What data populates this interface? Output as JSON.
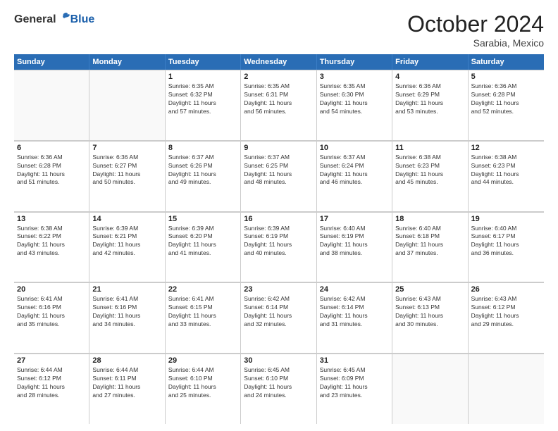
{
  "header": {
    "logo_general": "General",
    "logo_blue": "Blue",
    "month_title": "October 2024",
    "subtitle": "Sarabia, Mexico"
  },
  "days_of_week": [
    "Sunday",
    "Monday",
    "Tuesday",
    "Wednesday",
    "Thursday",
    "Friday",
    "Saturday"
  ],
  "weeks": [
    [
      {
        "day": "",
        "lines": []
      },
      {
        "day": "",
        "lines": []
      },
      {
        "day": "1",
        "lines": [
          "Sunrise: 6:35 AM",
          "Sunset: 6:32 PM",
          "Daylight: 11 hours",
          "and 57 minutes."
        ]
      },
      {
        "day": "2",
        "lines": [
          "Sunrise: 6:35 AM",
          "Sunset: 6:31 PM",
          "Daylight: 11 hours",
          "and 56 minutes."
        ]
      },
      {
        "day": "3",
        "lines": [
          "Sunrise: 6:35 AM",
          "Sunset: 6:30 PM",
          "Daylight: 11 hours",
          "and 54 minutes."
        ]
      },
      {
        "day": "4",
        "lines": [
          "Sunrise: 6:36 AM",
          "Sunset: 6:29 PM",
          "Daylight: 11 hours",
          "and 53 minutes."
        ]
      },
      {
        "day": "5",
        "lines": [
          "Sunrise: 6:36 AM",
          "Sunset: 6:28 PM",
          "Daylight: 11 hours",
          "and 52 minutes."
        ]
      }
    ],
    [
      {
        "day": "6",
        "lines": [
          "Sunrise: 6:36 AM",
          "Sunset: 6:28 PM",
          "Daylight: 11 hours",
          "and 51 minutes."
        ]
      },
      {
        "day": "7",
        "lines": [
          "Sunrise: 6:36 AM",
          "Sunset: 6:27 PM",
          "Daylight: 11 hours",
          "and 50 minutes."
        ]
      },
      {
        "day": "8",
        "lines": [
          "Sunrise: 6:37 AM",
          "Sunset: 6:26 PM",
          "Daylight: 11 hours",
          "and 49 minutes."
        ]
      },
      {
        "day": "9",
        "lines": [
          "Sunrise: 6:37 AM",
          "Sunset: 6:25 PM",
          "Daylight: 11 hours",
          "and 48 minutes."
        ]
      },
      {
        "day": "10",
        "lines": [
          "Sunrise: 6:37 AM",
          "Sunset: 6:24 PM",
          "Daylight: 11 hours",
          "and 46 minutes."
        ]
      },
      {
        "day": "11",
        "lines": [
          "Sunrise: 6:38 AM",
          "Sunset: 6:23 PM",
          "Daylight: 11 hours",
          "and 45 minutes."
        ]
      },
      {
        "day": "12",
        "lines": [
          "Sunrise: 6:38 AM",
          "Sunset: 6:23 PM",
          "Daylight: 11 hours",
          "and 44 minutes."
        ]
      }
    ],
    [
      {
        "day": "13",
        "lines": [
          "Sunrise: 6:38 AM",
          "Sunset: 6:22 PM",
          "Daylight: 11 hours",
          "and 43 minutes."
        ]
      },
      {
        "day": "14",
        "lines": [
          "Sunrise: 6:39 AM",
          "Sunset: 6:21 PM",
          "Daylight: 11 hours",
          "and 42 minutes."
        ]
      },
      {
        "day": "15",
        "lines": [
          "Sunrise: 6:39 AM",
          "Sunset: 6:20 PM",
          "Daylight: 11 hours",
          "and 41 minutes."
        ]
      },
      {
        "day": "16",
        "lines": [
          "Sunrise: 6:39 AM",
          "Sunset: 6:19 PM",
          "Daylight: 11 hours",
          "and 40 minutes."
        ]
      },
      {
        "day": "17",
        "lines": [
          "Sunrise: 6:40 AM",
          "Sunset: 6:19 PM",
          "Daylight: 11 hours",
          "and 38 minutes."
        ]
      },
      {
        "day": "18",
        "lines": [
          "Sunrise: 6:40 AM",
          "Sunset: 6:18 PM",
          "Daylight: 11 hours",
          "and 37 minutes."
        ]
      },
      {
        "day": "19",
        "lines": [
          "Sunrise: 6:40 AM",
          "Sunset: 6:17 PM",
          "Daylight: 11 hours",
          "and 36 minutes."
        ]
      }
    ],
    [
      {
        "day": "20",
        "lines": [
          "Sunrise: 6:41 AM",
          "Sunset: 6:16 PM",
          "Daylight: 11 hours",
          "and 35 minutes."
        ]
      },
      {
        "day": "21",
        "lines": [
          "Sunrise: 6:41 AM",
          "Sunset: 6:16 PM",
          "Daylight: 11 hours",
          "and 34 minutes."
        ]
      },
      {
        "day": "22",
        "lines": [
          "Sunrise: 6:41 AM",
          "Sunset: 6:15 PM",
          "Daylight: 11 hours",
          "and 33 minutes."
        ]
      },
      {
        "day": "23",
        "lines": [
          "Sunrise: 6:42 AM",
          "Sunset: 6:14 PM",
          "Daylight: 11 hours",
          "and 32 minutes."
        ]
      },
      {
        "day": "24",
        "lines": [
          "Sunrise: 6:42 AM",
          "Sunset: 6:14 PM",
          "Daylight: 11 hours",
          "and 31 minutes."
        ]
      },
      {
        "day": "25",
        "lines": [
          "Sunrise: 6:43 AM",
          "Sunset: 6:13 PM",
          "Daylight: 11 hours",
          "and 30 minutes."
        ]
      },
      {
        "day": "26",
        "lines": [
          "Sunrise: 6:43 AM",
          "Sunset: 6:12 PM",
          "Daylight: 11 hours",
          "and 29 minutes."
        ]
      }
    ],
    [
      {
        "day": "27",
        "lines": [
          "Sunrise: 6:44 AM",
          "Sunset: 6:12 PM",
          "Daylight: 11 hours",
          "and 28 minutes."
        ]
      },
      {
        "day": "28",
        "lines": [
          "Sunrise: 6:44 AM",
          "Sunset: 6:11 PM",
          "Daylight: 11 hours",
          "and 27 minutes."
        ]
      },
      {
        "day": "29",
        "lines": [
          "Sunrise: 6:44 AM",
          "Sunset: 6:10 PM",
          "Daylight: 11 hours",
          "and 25 minutes."
        ]
      },
      {
        "day": "30",
        "lines": [
          "Sunrise: 6:45 AM",
          "Sunset: 6:10 PM",
          "Daylight: 11 hours",
          "and 24 minutes."
        ]
      },
      {
        "day": "31",
        "lines": [
          "Sunrise: 6:45 AM",
          "Sunset: 6:09 PM",
          "Daylight: 11 hours",
          "and 23 minutes."
        ]
      },
      {
        "day": "",
        "lines": []
      },
      {
        "day": "",
        "lines": []
      }
    ]
  ]
}
